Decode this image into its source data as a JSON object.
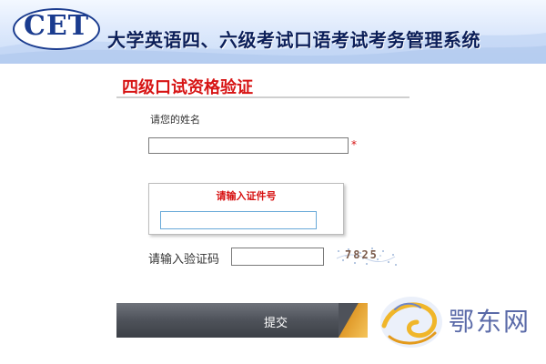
{
  "header": {
    "logo_text": "CET",
    "title": "大学英语四、六级考试口语考试考务管理系统"
  },
  "form": {
    "section_title": "四级口试资格验证",
    "name": {
      "label": "请您的姓名",
      "value": "",
      "required_marker": "*"
    },
    "id_card": {
      "prompt": "请输入证件号",
      "value": ""
    },
    "captcha": {
      "label": "请输入验证码",
      "value": "",
      "image_code": "7825"
    },
    "submit_label": "提交"
  },
  "watermark": {
    "text": "鄂东网",
    "icon": "yellow-dragon-swirl-icon"
  },
  "colors": {
    "accent_red": "#d71414",
    "banner_blue": "#1b3c8f",
    "button_dark": "#4e525a",
    "button_accent": "#f5c55b",
    "id_field_border": "#68a9d8"
  }
}
